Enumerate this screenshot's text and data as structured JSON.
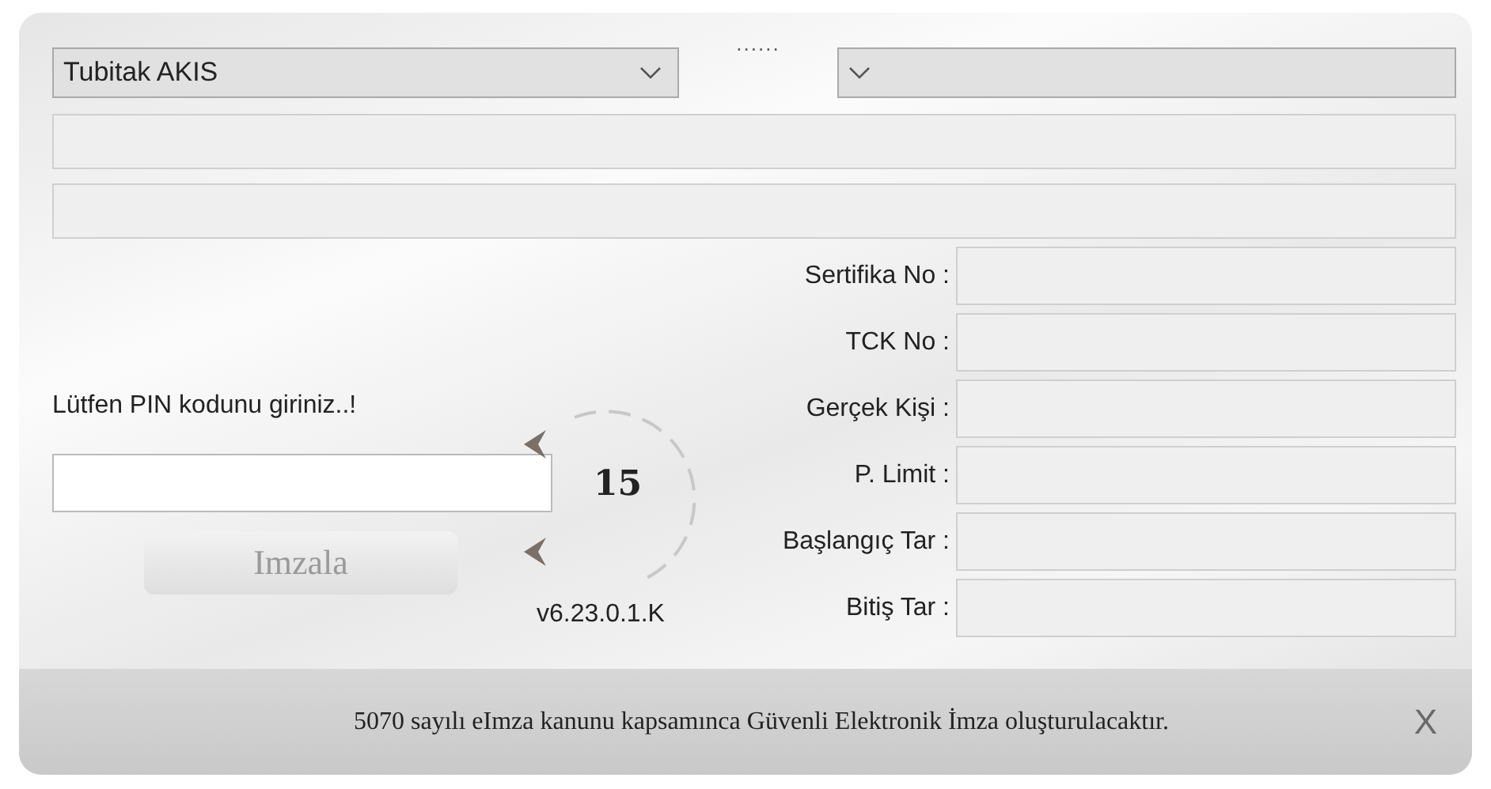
{
  "reader_select": {
    "value": "Tubitak AKIS"
  },
  "dots": "......",
  "pin_prompt": "Lütfen PIN kodunu giriniz..!",
  "countdown": "15",
  "sign_button": "Imzala",
  "version": "v6.23.0.1.K",
  "certificate_fields": [
    {
      "label": "Sertifika No :"
    },
    {
      "label": "TCK No :"
    },
    {
      "label": "Gerçek Kişi :"
    },
    {
      "label": "P. Limit :"
    },
    {
      "label": "Başlangıç Tar :"
    },
    {
      "label": "Bitiş Tar :"
    }
  ],
  "footer": {
    "message": "5070 sayılı eImza kanunu kapsamınca Güvenli Elektronik İmza oluşturulacaktır.",
    "close": "X"
  }
}
